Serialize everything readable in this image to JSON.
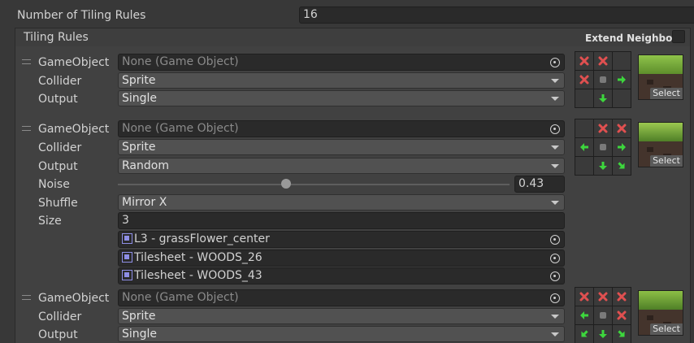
{
  "header": {
    "rule_count_label": "Number of Tiling Rules",
    "rule_count_value": "16"
  },
  "section": {
    "title": "Tiling Rules",
    "extend_neighbor_label": "Extend Neighbor"
  },
  "labels": {
    "gameobject": "GameObject",
    "collider": "Collider",
    "output": "Output",
    "noise": "Noise",
    "shuffle": "Shuffle",
    "size": "Size",
    "select": "Select"
  },
  "rules": [
    {
      "gameobject": "None (Game Object)",
      "collider": "Sprite",
      "output": "Single",
      "grid": [
        "x",
        "x",
        "",
        "x",
        "c",
        "right",
        "",
        "down",
        ""
      ]
    },
    {
      "gameobject": "None (Game Object)",
      "collider": "Sprite",
      "output": "Random",
      "noise": "0.43",
      "noise_fraction": 0.43,
      "shuffle": "Mirror X",
      "size": "3",
      "sprites": [
        "L3 - grassFlower_center",
        "Tilesheet - WOODS_26",
        "Tilesheet - WOODS_43"
      ],
      "grid": [
        "",
        "x",
        "x",
        "left",
        "c",
        "right",
        "",
        "down",
        "down-right"
      ]
    },
    {
      "gameobject": "None (Game Object)",
      "collider": "Sprite",
      "output": "Single",
      "grid": [
        "x",
        "x",
        "x",
        "left",
        "c",
        "x",
        "down-left",
        "down",
        "down-right"
      ]
    }
  ],
  "colors": {
    "background": "#383838",
    "field": "#2a2a2a",
    "dropdown": "#515151",
    "cross": "#e05050",
    "arrow": "#3dd63d"
  }
}
